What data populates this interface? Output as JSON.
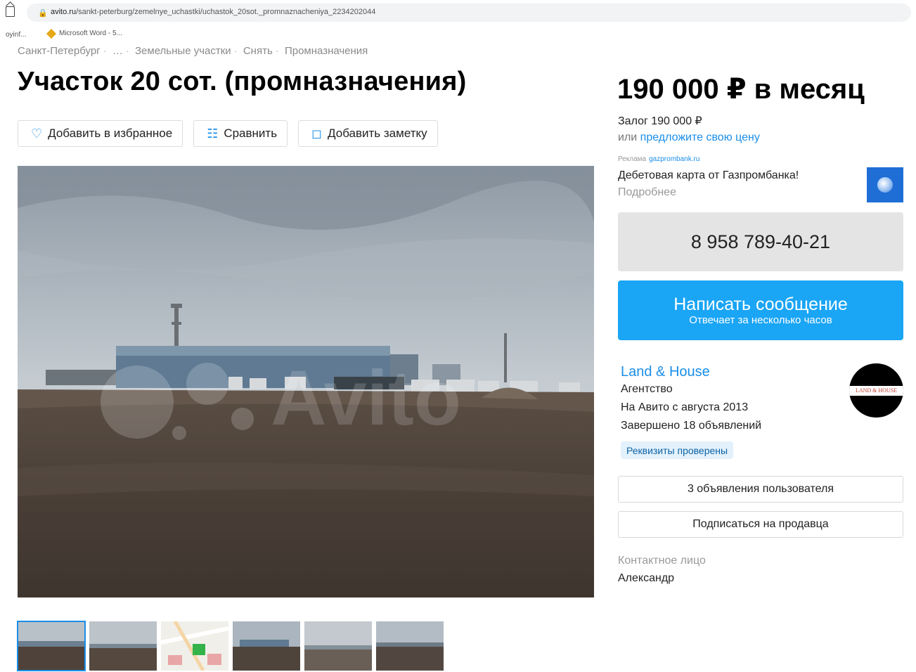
{
  "browser": {
    "url_host": "avito.ru",
    "url_path": "/sankt-peterburg/zemelnye_uchastki/uchastok_20sot._promnaznacheniya_2234202044",
    "bookmark_1": "oyinf...",
    "bookmark_2": "Microsoft Word - 5..."
  },
  "breadcrumbs": [
    "Санкт-Петербург",
    "…",
    "Земельные участки",
    "Снять",
    "Промназначения"
  ],
  "breadcrumb_separator": "·",
  "listing": {
    "title": "Участок 20 сот. (промназначения)",
    "actions": {
      "favorite_label": "Добавить в избранное",
      "compare_label": "Сравнить",
      "note_label": "Добавить заметку"
    }
  },
  "pricing": {
    "price": "190 000 ₽ в месяц",
    "deposit": "Залог 190 000 ₽",
    "offer_prefix": "или",
    "offer_link": "предложите свою цену"
  },
  "ad": {
    "label": "Реклама",
    "domain": "gazprombank.ru",
    "text": "Дебетовая карта от Газпромбанка!",
    "more": "Подробнее"
  },
  "contact": {
    "phone": "8 958 789-40-21",
    "message_label": "Написать сообщение",
    "message_sub": "Отвечает за несколько часов"
  },
  "seller": {
    "name": "Land & House",
    "type": "Агентство",
    "since": "На Авито с августа 2013",
    "completed": "Завершено 18 объявлений",
    "verified_badge": "Реквизиты проверены",
    "logo_text": "LAND & HOUSE",
    "other_listings": "3 объявления пользователя",
    "subscribe": "Подписаться на продавца",
    "contact_label": "Контактное лицо",
    "contact_name": "Александр"
  },
  "gallery": {
    "watermark": "Avito",
    "thumbnails": [
      "photo-1",
      "photo-2",
      "map",
      "photo-4",
      "photo-5",
      "photo-6"
    ],
    "active_index": 0
  },
  "colors": {
    "accent": "#1a8ee8",
    "message_button": "#1aa5f5",
    "phone_button": "#e4e4e4"
  }
}
